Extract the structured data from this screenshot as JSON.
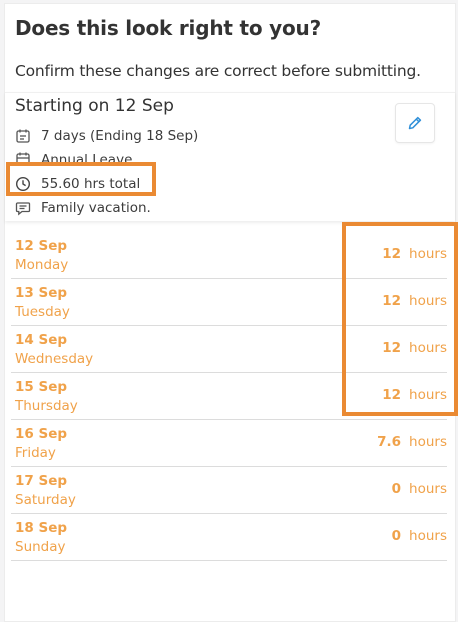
{
  "dialog": {
    "title": "Does this look right to you?",
    "subtitle": "Confirm these changes are correct before submitting."
  },
  "summary": {
    "starting": "Starting on 12 Sep",
    "duration": "7 days (Ending 18 Sep)",
    "leave_type": "Annual Leave",
    "total": "55.60 hrs total",
    "note": "Family vacation.",
    "icons": {
      "duration": "calendar-range-icon",
      "leave_type": "calendar-icon",
      "total": "clock-icon",
      "note": "comment-icon",
      "edit": "pencil-icon"
    }
  },
  "days": [
    {
      "date": "12 Sep",
      "weekday": "Monday",
      "hours": "12",
      "unit": "hours"
    },
    {
      "date": "13 Sep",
      "weekday": "Tuesday",
      "hours": "12",
      "unit": "hours"
    },
    {
      "date": "14 Sep",
      "weekday": "Wednesday",
      "hours": "12",
      "unit": "hours"
    },
    {
      "date": "15 Sep",
      "weekday": "Thursday",
      "hours": "12",
      "unit": "hours"
    },
    {
      "date": "16 Sep",
      "weekday": "Friday",
      "hours": "7.6",
      "unit": "hours"
    },
    {
      "date": "17 Sep",
      "weekday": "Saturday",
      "hours": "0",
      "unit": "hours"
    },
    {
      "date": "18 Sep",
      "weekday": "Sunday",
      "hours": "0",
      "unit": "hours"
    }
  ],
  "colors": {
    "accent": "#f0a24a",
    "highlight": "#ea8a33",
    "edit_icon": "#2f8fd8"
  }
}
